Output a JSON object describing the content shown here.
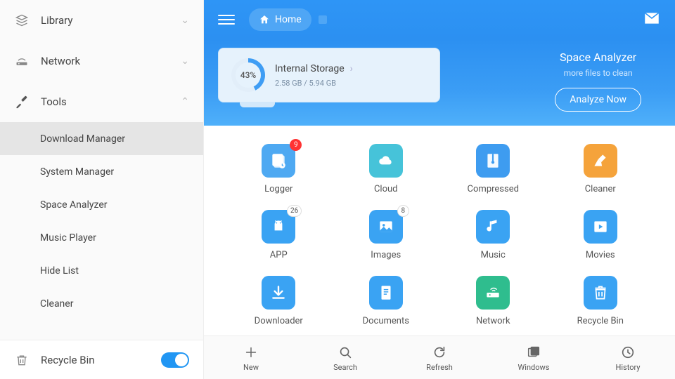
{
  "sidebar": {
    "library": "Library",
    "network": "Network",
    "tools": "Tools",
    "items": [
      "Download Manager",
      "System Manager",
      "Space Analyzer",
      "Music Player",
      "Hide List",
      "Cleaner"
    ],
    "recycle": "Recycle Bin"
  },
  "topbar": {
    "home": "Home"
  },
  "storage": {
    "percent": "43%",
    "name": "Internal Storage",
    "size": "2.58 GB / 5.94 GB"
  },
  "analyzer": {
    "title": "Space Analyzer",
    "subtitle": "more files to clean",
    "button": "Analyze Now"
  },
  "grid": [
    {
      "label": "Logger",
      "color": "#4ea9f2",
      "badge": "9",
      "badgeRed": true,
      "icon": "logger"
    },
    {
      "label": "Cloud",
      "color": "#46c3d9",
      "icon": "cloud"
    },
    {
      "label": "Compressed",
      "color": "#3e9cf0",
      "icon": "zip"
    },
    {
      "label": "Cleaner",
      "color": "#f5a33b",
      "icon": "broom"
    },
    {
      "label": "APP",
      "color": "#3aa3f3",
      "badge": "26",
      "icon": "android"
    },
    {
      "label": "Images",
      "color": "#3aa3f3",
      "badge": "8",
      "icon": "image"
    },
    {
      "label": "Music",
      "color": "#3aa3f3",
      "icon": "music"
    },
    {
      "label": "Movies",
      "color": "#3aa3f3",
      "icon": "play"
    },
    {
      "label": "Downloader",
      "color": "#3aa3f3",
      "icon": "down"
    },
    {
      "label": "Documents",
      "color": "#3aa3f3",
      "icon": "doc"
    },
    {
      "label": "Network",
      "color": "#2fbd8e",
      "icon": "router"
    },
    {
      "label": "Recycle Bin",
      "color": "#3aa3f3",
      "icon": "trash"
    }
  ],
  "gridPartial": [
    {
      "color": "#f5a33b"
    },
    {
      "color": "#3aa3f3"
    },
    {
      "color": "#3aa3f3"
    },
    {
      "color": "#3aa3f3"
    }
  ],
  "bottombar": [
    {
      "label": "New",
      "icon": "plus"
    },
    {
      "label": "Search",
      "icon": "search"
    },
    {
      "label": "Refresh",
      "icon": "refresh"
    },
    {
      "label": "Windows",
      "icon": "windows"
    },
    {
      "label": "History",
      "icon": "clock"
    }
  ]
}
